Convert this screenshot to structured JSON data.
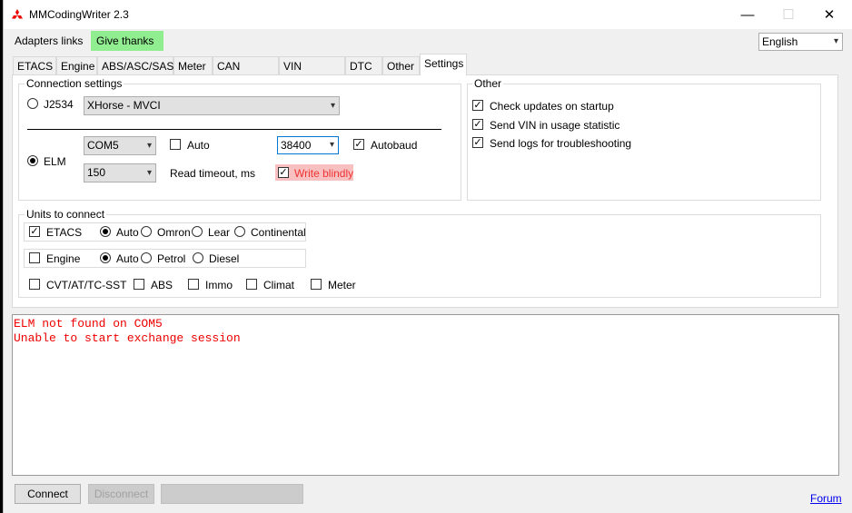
{
  "window": {
    "title": "MMCodingWriter 2.3",
    "minimize": "—",
    "maximize": "☐",
    "close": "✕"
  },
  "menu": {
    "adapters_links": "Adapters links",
    "give_thanks": "Give thanks",
    "language": "English"
  },
  "tabs": [
    "ETACS",
    "Engine",
    "ABS/ASC/SAS",
    "Meter",
    "CAN adapter",
    "VIN Changer",
    "DTC",
    "Other",
    "Settings"
  ],
  "active_tab": "Settings",
  "connection": {
    "title": "Connection settings",
    "j2534_label": "J2534",
    "j2534_device": "XHorse - MVCI",
    "elm_label": "ELM",
    "port": "COM5",
    "auto_label": "Auto",
    "baud": "38400",
    "autobaud_label": "Autobaud",
    "timeout": "150",
    "timeout_label": "Read timeout, ms",
    "write_blindly_label": "Write blindly"
  },
  "other": {
    "title": "Other",
    "check_updates": "Check updates on startup",
    "send_vin": "Send VIN in usage statistic",
    "send_logs": "Send logs for troubleshooting"
  },
  "units": {
    "title": "Units to connect",
    "etacs": "ETACS",
    "etacs_options": [
      "Auto",
      "Omron",
      "Lear",
      "Continental"
    ],
    "engine": "Engine",
    "engine_options": [
      "Auto",
      "Petrol",
      "Diesel"
    ],
    "others": [
      "CVT/AT/TC-SST",
      "ABS",
      "Immo",
      "Climat",
      "Meter"
    ]
  },
  "log": [
    "ELM not found on COM5",
    "Unable to start exchange session"
  ],
  "buttons": {
    "connect": "Connect",
    "disconnect": "Disconnect",
    "forum": "Forum"
  },
  "colors": {
    "accent_green": "#90ee90",
    "log_red": "#e00000",
    "highlight_pink": "#f8c0c0"
  }
}
